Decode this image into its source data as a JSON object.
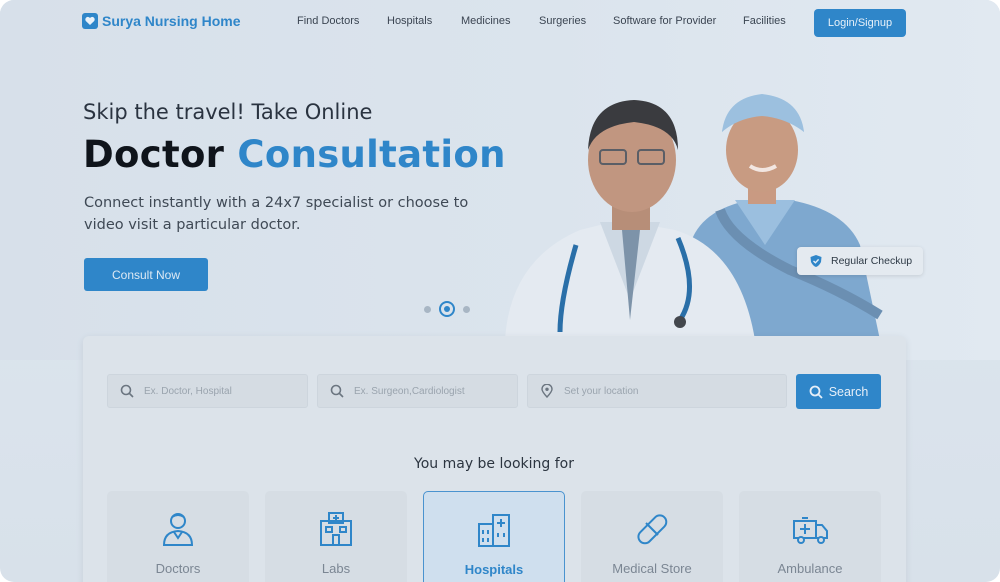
{
  "brand": {
    "name": "Surya Nursing Home",
    "color": "#2f86c9",
    "icon": "heart-shield-icon"
  },
  "nav": {
    "items": [
      "Find Doctors",
      "Hospitals",
      "Medicines",
      "Surgeries",
      "Software for Provider",
      "Facilities"
    ],
    "login_label": "Login/Signup"
  },
  "hero": {
    "tagline": "Skip the travel! Take Online",
    "headline_dark": "Doctor",
    "headline_blue": "Consultation",
    "description": "Connect instantly with a 24x7 specialist or choose to video visit a particular doctor.",
    "cta_label": "Consult Now",
    "badge_label": "Regular Checkup",
    "carousel_active_index": 1
  },
  "search": {
    "doctor_placeholder": "Ex. Doctor, Hospital",
    "specialty_placeholder": "Ex. Surgeon,Cardiologist",
    "location_placeholder": "Set your location",
    "button_label": "Search"
  },
  "categories": {
    "heading": "You may be looking for",
    "items": [
      {
        "label": "Doctors",
        "icon": "doctor-icon"
      },
      {
        "label": "Labs",
        "icon": "lab-icon"
      },
      {
        "label": "Hospitals",
        "icon": "hospital-icon",
        "selected": true
      },
      {
        "label": "Medical Store",
        "icon": "pill-icon"
      },
      {
        "label": "Ambulance",
        "icon": "ambulance-icon"
      }
    ]
  }
}
